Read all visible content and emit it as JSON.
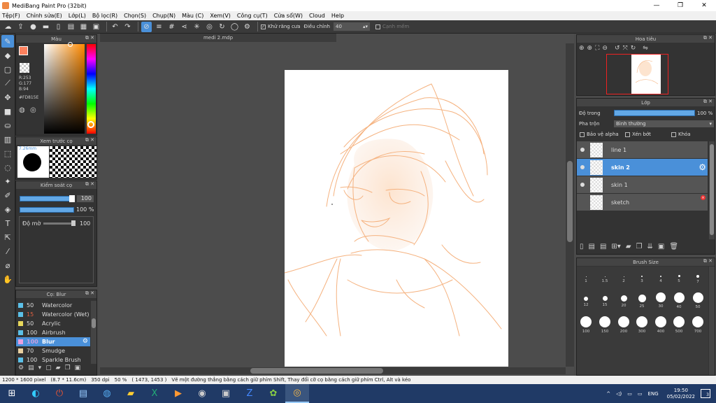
{
  "window": {
    "title": "MediBang Paint Pro (32bit)",
    "min": "—",
    "max": "❐",
    "close": "✕"
  },
  "menu": [
    "Tệp(F)",
    "Chỉnh sửa(E)",
    "Lớp(L)",
    "Bộ lọc(R)",
    "Chọn(S)",
    "Chụp(N)",
    "Màu (C)",
    "Xem(V)",
    "Công cụ(T)",
    "Cửa sổ(W)",
    "Cloud",
    "Help"
  ],
  "toolbar": {
    "antialias_label": "Khử răng cưa",
    "adjust_label": "Điều chỉnh",
    "adjust_value": "40",
    "smooth_label": "Cạnh mềm"
  },
  "color_panel": {
    "title": "Màu",
    "r": "R:253",
    "g": "G:177",
    "b": "B:94",
    "hex": "#FD815E",
    "fg": "#fd815e"
  },
  "brush_preview": {
    "title": "Xem trước cọ",
    "size": "7.26mm"
  },
  "brush_control": {
    "title": "Kiểm soát cọ",
    "size_value": "100",
    "opacity_value": "100 %",
    "density_label": "Độ mờ",
    "density_value": "100"
  },
  "brush_list": {
    "title": "Cọ: Blur",
    "items": [
      {
        "size": "50",
        "name": "Watercolor",
        "color": "#5bc0e8"
      },
      {
        "size": "15",
        "name": "Watercolor (Wet)",
        "color": "#5bc0e8"
      },
      {
        "size": "50",
        "name": "Acrylic",
        "color": "#e8d85b"
      },
      {
        "size": "100",
        "name": "Airbrush",
        "color": "#5bc0e8"
      },
      {
        "size": "100",
        "name": "Blur",
        "color": "#e8a0e0",
        "selected": true
      },
      {
        "size": "70",
        "name": "Smudge",
        "color": "#e8d0a0"
      },
      {
        "size": "100",
        "name": "Sparkle Brush",
        "color": "#5bc0e8"
      }
    ]
  },
  "document": {
    "tab": "medi 2.mdp"
  },
  "navigator": {
    "title": "Hoa tiêu"
  },
  "layers": {
    "title": "Lớp",
    "opacity_label": "Độ trong",
    "opacity_value": "100 %",
    "blend_label": "Pha trộn",
    "blend_value": "Bình thường",
    "protect_alpha": "Bảo vệ alpha",
    "clipping": "Xén bớt",
    "lock": "Khóa",
    "items": [
      {
        "name": "line 1",
        "visible": true
      },
      {
        "name": "skin 2",
        "visible": true,
        "selected": true
      },
      {
        "name": "skin 1",
        "visible": true
      },
      {
        "name": "sketch",
        "visible": false
      }
    ]
  },
  "brush_size": {
    "title": "Brush Size",
    "sizes": [
      "1",
      "1.5",
      "2",
      "3",
      "4",
      "5",
      "7",
      "12",
      "15",
      "20",
      "25",
      "30",
      "40",
      "50",
      "100",
      "150",
      "200",
      "300",
      "400",
      "500",
      "700"
    ]
  },
  "status": {
    "dims": "1200 * 1600 pixel",
    "physical": "(8.7 * 11.6cm)",
    "dpi": "350 dpi",
    "zoom": "50 %",
    "coords": "( 1473, 1453 )",
    "hint": "Vẽ một đường thẳng bằng cách giữ phím Shift, Thay đổi cỡ cọ bằng cách giữ phím Ctrl, Alt và kéo"
  },
  "taskbar": {
    "lang": "ENG",
    "time": "19:50",
    "date": "05/02/2022",
    "notif": "3"
  },
  "sketch_color": "#f5b27f"
}
